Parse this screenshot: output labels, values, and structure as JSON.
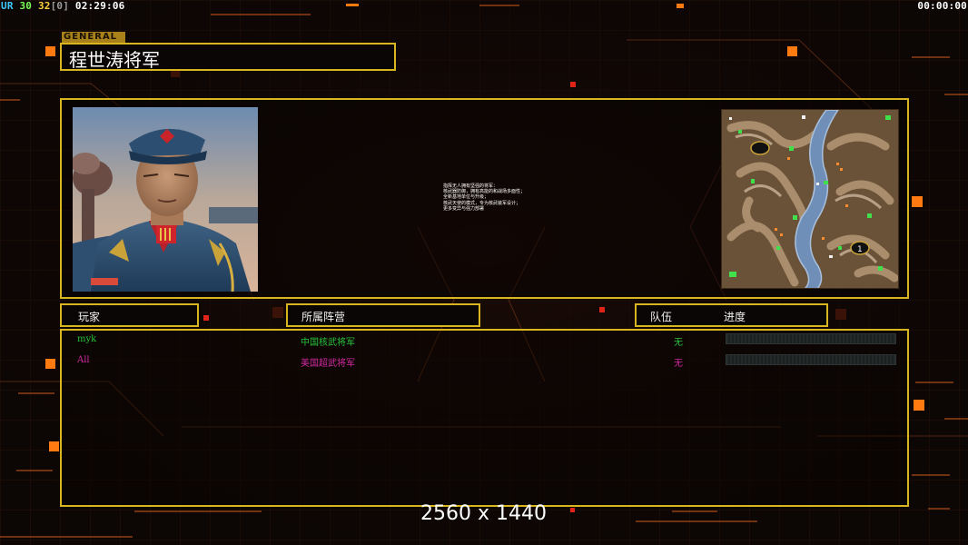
{
  "hud": {
    "left_parts": [
      {
        "text": "UR",
        "color": "#3ec8ff"
      },
      {
        "text": " 30 ",
        "color": "#7dff5a"
      },
      {
        "text": "32",
        "color": "#ffd23c"
      },
      {
        "text": "[0]",
        "color": "#9a9a9a"
      },
      {
        "text": " 02:29:06",
        "color": "#ffffff"
      }
    ],
    "right_time": "00:00:00"
  },
  "general": {
    "tag": "GENERAL",
    "name": "程世涛将军"
  },
  "description_lines": [
    "指挥无人拥有坚强的将军：",
    "核武器防御，拥有高能的和战场多面性；",
    "全新基地单位与升级；",
    "核武天使的模式，专为核武装军设计；",
    "更多变异与强力部署"
  ],
  "headers": {
    "player": "玩家",
    "faction": "所属阵营",
    "team": "队伍",
    "progress": "进度"
  },
  "players": [
    {
      "name": "myk",
      "faction": "中国核武将军",
      "team": "无",
      "color": "#26c43a",
      "progress": 0
    },
    {
      "name": "All",
      "faction": "美国超武将军",
      "team": "无",
      "color": "#d22aa2",
      "progress": 0
    }
  ],
  "resolution": "2560 x 1440",
  "colors": {
    "frame": "#d9b520",
    "accent_orange": "#ff7a10"
  }
}
